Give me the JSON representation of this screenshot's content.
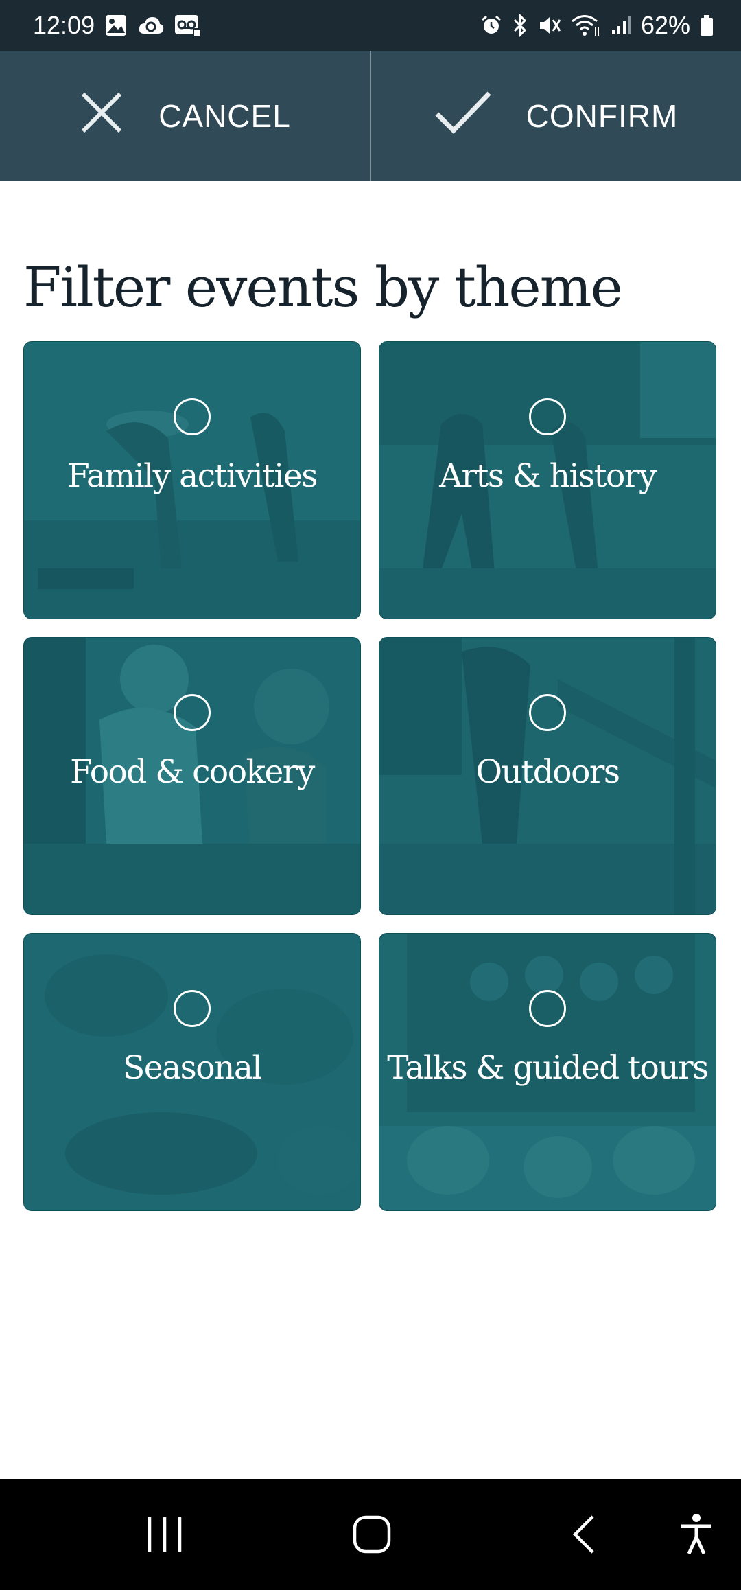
{
  "status_bar": {
    "time": "12:09",
    "battery": "62%",
    "left_icons": [
      "image-icon",
      "cloud-sync-icon",
      "voicemail-icon"
    ],
    "right_icons": [
      "alarm-icon",
      "bluetooth-icon",
      "mute-icon",
      "wifi-icon",
      "signal-icon",
      "battery-icon"
    ]
  },
  "action_bar": {
    "cancel_label": "CANCEL",
    "confirm_label": "CONFIRM",
    "cancel_icon": "close-icon",
    "confirm_icon": "check-icon"
  },
  "page": {
    "title": "Filter events by theme"
  },
  "themes": [
    {
      "label": "Family activities",
      "selected": false
    },
    {
      "label": "Arts & history",
      "selected": false
    },
    {
      "label": "Food & cookery",
      "selected": false
    },
    {
      "label": "Outdoors",
      "selected": false
    },
    {
      "label": "Seasonal",
      "selected": false
    },
    {
      "label": "Talks & guided tours",
      "selected": false
    }
  ],
  "nav_bar": {
    "items": [
      "recent-apps-icon",
      "home-icon",
      "back-icon",
      "accessibility-icon"
    ]
  },
  "colors": {
    "status_bar": "#1b2a33",
    "action_bar": "#304a57",
    "tile_overlay": "#1e6a72",
    "title_text": "#16232c"
  }
}
